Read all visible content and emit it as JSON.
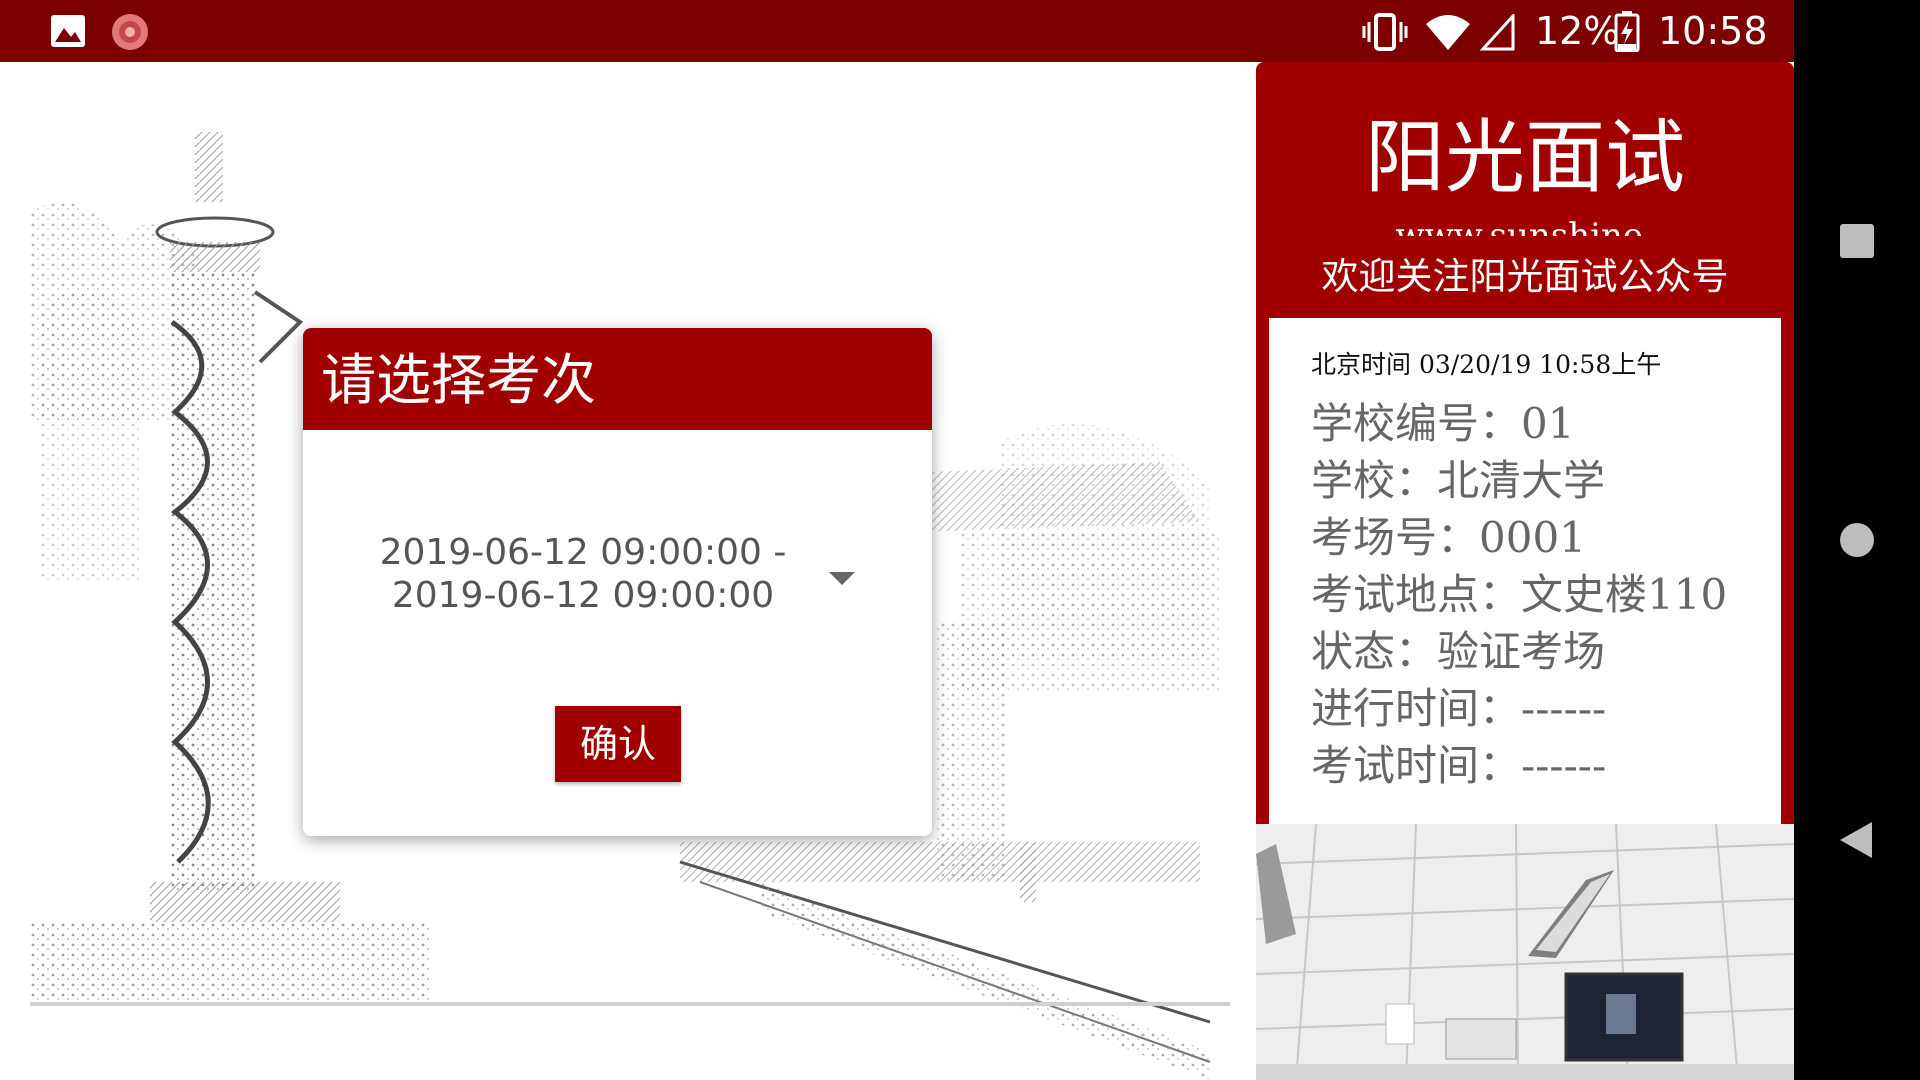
{
  "status_bar": {
    "battery_text": "12%",
    "time": "10:58",
    "icons": [
      "gallery-icon",
      "app-notification-icon",
      "vibrate-icon",
      "wifi-icon",
      "cell-signal-icon",
      "battery-charging-icon"
    ]
  },
  "nav_bar": {
    "icons": [
      "recents-icon",
      "home-icon",
      "back-icon"
    ]
  },
  "dialog": {
    "title": "请选择考次",
    "session_line1": "2019-06-12 09:00:00 -",
    "session_line2": "2019-06-12 09:00:00",
    "confirm_label": "确认"
  },
  "info_panel": {
    "brand_title": "阳光面试",
    "brand_url": "www.sunshine-",
    "follow_text": "欢迎关注阳光面试公众号",
    "beijing_time": "北京时间 03/20/19 10:58上午",
    "rows": [
      "学校编号：01",
      "学校：北清大学",
      "考场号：0001",
      "考试地点：文史楼110",
      "状态：验证考场",
      "进行时间：------",
      "考试时间：------"
    ]
  },
  "colors": {
    "status_bar": "#7d0000",
    "brand_red": "#a00000",
    "nav_bar": "#000000"
  }
}
